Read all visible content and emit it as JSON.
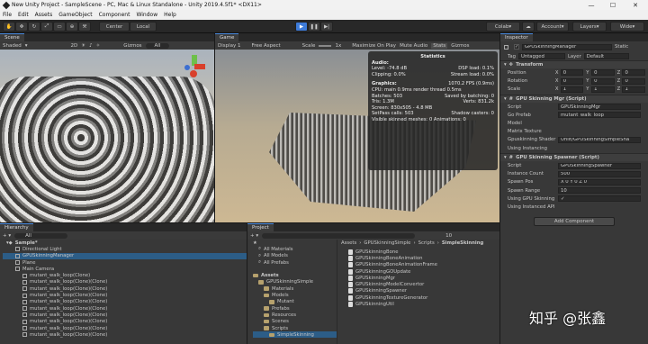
{
  "window": {
    "title": "New Unity Project - SampleScene - PC, Mac & Linux Standalone - Unity 2019.4.5f1* <DX11>"
  },
  "menu": [
    "File",
    "Edit",
    "Assets",
    "GameObject",
    "Component",
    "Window",
    "Help"
  ],
  "toolbar": {
    "center": "Center",
    "local": "Local",
    "colab": "Colab",
    "account": "Account",
    "layers": "Layers",
    "layout": "Wide"
  },
  "scene": {
    "tab": "Scene",
    "shading": "Shaded",
    "mode": "2D",
    "gizmos": "Gizmos",
    "search_ph": "All"
  },
  "game": {
    "tab": "Game",
    "display": "Display 1",
    "aspect": "Free Aspect",
    "scale_label": "Scale",
    "scale_val": "1x",
    "maximize": "Maximize On Play",
    "mute": "Mute Audio",
    "stats": "Stats",
    "gizmos": "Gizmos"
  },
  "stats": {
    "title": "Statistics",
    "audio": "Audio:",
    "level": "Level: -74.8 dB",
    "dsp": "DSP load: 0.1%",
    "clipping": "Clipping: 0.0%",
    "stream": "Stream load: 0.0%",
    "graphics": "Graphics:",
    "fps": "1070.2 FPS (0.9ms)",
    "cpu": "CPU: main 0.9ms  render thread 0.5ms",
    "batches": "Batches: 503",
    "saved": "Saved by batching: 0",
    "tris": "Tris: 1.3M",
    "verts": "Verts: 831.2k",
    "screen": "Screen: 830x505 - 4.8 MB",
    "setpass": "SetPass calls: 503",
    "shadow": "Shadow casters: 0",
    "skinned": "Visible skinned meshes: 0  Animations: 0"
  },
  "hierarchy": {
    "tab": "Hierarchy",
    "search_ph": "All",
    "items": [
      "Sample*",
      "Directional Light",
      "GPUSkinningManager",
      "Plane",
      "Main Camera",
      "mutant_walk_loop(Clone)",
      "mutant_walk_loop(Clone)(Clone)",
      "mutant_walk_loop(Clone)(Clone)",
      "mutant_walk_loop(Clone)(Clone)",
      "mutant_walk_loop(Clone)(Clone)",
      "mutant_walk_loop(Clone)(Clone)",
      "mutant_walk_loop(Clone)(Clone)",
      "mutant_walk_loop(Clone)(Clone)",
      "mutant_walk_loop(Clone)(Clone)",
      "mutant_walk_loop(Clone)(Clone)"
    ]
  },
  "project": {
    "tab": "Project",
    "favorites": [
      "All Materials",
      "All Models",
      "All Prefabs"
    ],
    "tree": [
      "Assets",
      "GPUSkinningSimple",
      "Materials",
      "Models",
      "Mutant",
      "Prefabs",
      "Resources",
      "Scenes",
      "Scripts",
      "SimpleSkinning"
    ],
    "breadcrumb": [
      "Assets",
      "GPUSkinningSimple",
      "Scripts",
      "SimpleSkinning"
    ],
    "files": [
      "GPUSkinningBone",
      "GPUSkinningBoneAnimation",
      "GPUSkinningBoneAnimationFrame",
      "GPUSkinningGOUpdate",
      "GPUSkinningMgr",
      "GPUSkinningModelConvertor",
      "GPUSkinningSpawner",
      "GPUSkinningTextureGenerator",
      "GPUSkinningUtil"
    ],
    "count": "10"
  },
  "inspector": {
    "tab": "Inspector",
    "object": "GPUSkinningManager",
    "static": "Static",
    "tag_label": "Tag",
    "tag": "Untagged",
    "layer_label": "Layer",
    "layer": "Default",
    "transform": {
      "title": "Transform",
      "rows": [
        {
          "label": "Position",
          "x": "0",
          "y": "0",
          "z": "0"
        },
        {
          "label": "Rotation",
          "x": "0",
          "y": "0",
          "z": "0"
        },
        {
          "label": "Scale",
          "x": "1",
          "y": "1",
          "z": "1"
        }
      ]
    },
    "mgr": {
      "title": "GPU Skinning Mgr (Script)",
      "rows": [
        {
          "label": "Script",
          "value": "GPUSkinningMgr"
        },
        {
          "label": "Go Prefab",
          "value": "mutant_walk_loop"
        },
        {
          "label": "Model",
          "value": ""
        },
        {
          "label": "Matrix Texture",
          "value": ""
        },
        {
          "label": "Gpuskinning Shader",
          "value": "Unlit/GPUSkinningSimpleSha"
        },
        {
          "label": "Using Instancing",
          "value": ""
        }
      ]
    },
    "spawner": {
      "title": "GPU Skinning Spawner (Script)",
      "rows": [
        {
          "label": "Script",
          "value": "GPUSkinningSpawner"
        },
        {
          "label": "Instance Count",
          "value": "500"
        },
        {
          "label": "Spawn Pos",
          "value": "X 0   Y 0   Z 0"
        },
        {
          "label": "Spawn Range",
          "value": "10"
        },
        {
          "label": "Using GPU Skinning",
          "value": "✓"
        },
        {
          "label": "Using Instanced API",
          "value": ""
        }
      ]
    },
    "add_component": "Add Component"
  },
  "watermark": "知乎 @张鑫",
  "colors": {
    "accent": "#3d7bd9",
    "title_bg": "#f2f2f2",
    "panel": "#383838"
  }
}
